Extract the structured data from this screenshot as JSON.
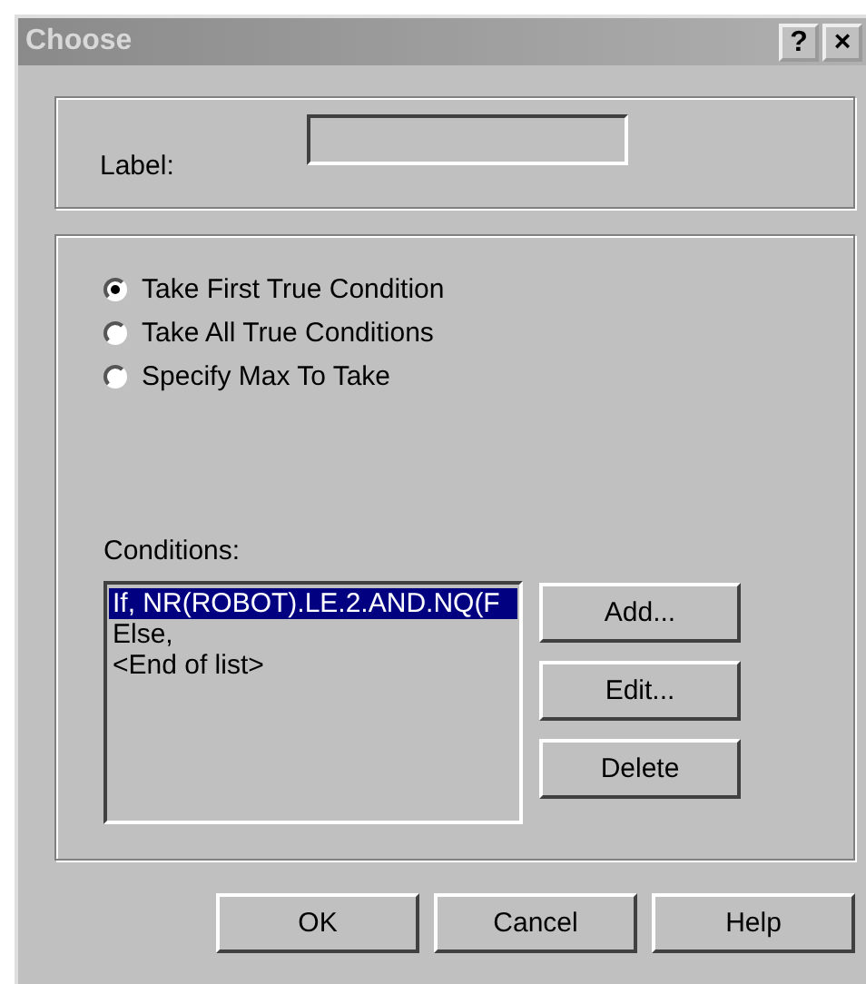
{
  "window": {
    "title": "Choose",
    "title_buttons": [
      "?",
      "×"
    ]
  },
  "label_field": {
    "label": "Label:"
  },
  "options": [
    {
      "label": "Take First True Condition",
      "selected": true
    },
    {
      "label": "Take All True Conditions",
      "selected": false
    },
    {
      "label": "Specify Max To Take",
      "selected": false
    }
  ],
  "conditions": {
    "label": "Conditions:",
    "items": [
      {
        "text": "If, NR(ROBOT).LE.2.AND.NQ(F",
        "selected": true
      },
      {
        "text": "Else,",
        "selected": false
      },
      {
        "text": "<End of list>",
        "selected": false
      }
    ],
    "buttons": [
      "Add...",
      "Edit...",
      "Delete"
    ]
  },
  "buttons": [
    "OK",
    "Cancel",
    "Help"
  ]
}
